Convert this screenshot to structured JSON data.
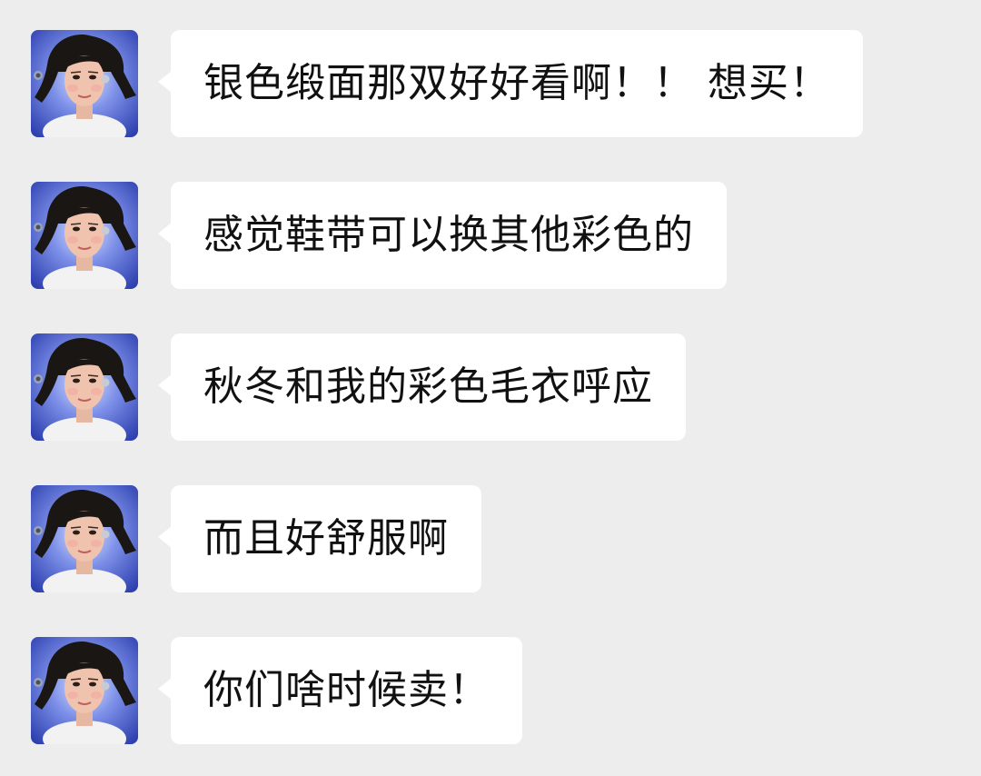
{
  "chat": {
    "messages": [
      {
        "sender_avatar": "woman-avatar-icon",
        "text": "银色缎面那双好好看啊！！ 想买！"
      },
      {
        "sender_avatar": "woman-avatar-icon",
        "text": "感觉鞋带可以换其他彩色的"
      },
      {
        "sender_avatar": "woman-avatar-icon",
        "text": "秋冬和我的彩色毛衣呼应"
      },
      {
        "sender_avatar": "woman-avatar-icon",
        "text": "而且好舒服啊"
      },
      {
        "sender_avatar": "woman-avatar-icon",
        "text": "你们啥时候卖！"
      }
    ]
  },
  "colors": {
    "background": "#ededed",
    "bubble": "#ffffff",
    "text": "#111111",
    "avatar_bg": "#3f56c8"
  }
}
